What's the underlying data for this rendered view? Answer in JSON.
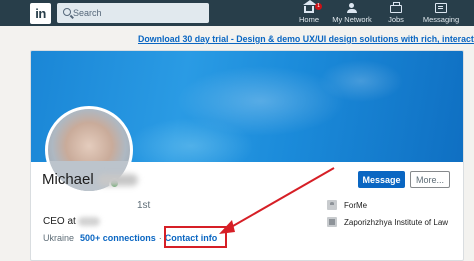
{
  "nav": {
    "logo": "in",
    "search_placeholder": "Search",
    "items": [
      {
        "label": "Home",
        "icon": "home-icon",
        "badge": "1"
      },
      {
        "label": "My Network",
        "icon": "people-icon"
      },
      {
        "label": "Jobs",
        "icon": "briefcase-icon"
      },
      {
        "label": "Messaging",
        "icon": "message-icon"
      }
    ]
  },
  "promo": {
    "link": "Download 30 day trial",
    "text": " - Design & demo UX/UI design solutions with rich, interactive pr"
  },
  "profile": {
    "first_name": "Michael",
    "degree": "1st",
    "headline": "CEO at",
    "location": "Ukraine",
    "connections": "500+ connections",
    "contact_info": "Contact info",
    "message_button": "Message",
    "more_button": "More...",
    "company": "ForMe",
    "school": "Zaporizhzhya Institute of Law"
  },
  "colors": {
    "nav_bg": "#283e4a",
    "accent": "#0a66c2",
    "highlight": "#d61f26"
  }
}
